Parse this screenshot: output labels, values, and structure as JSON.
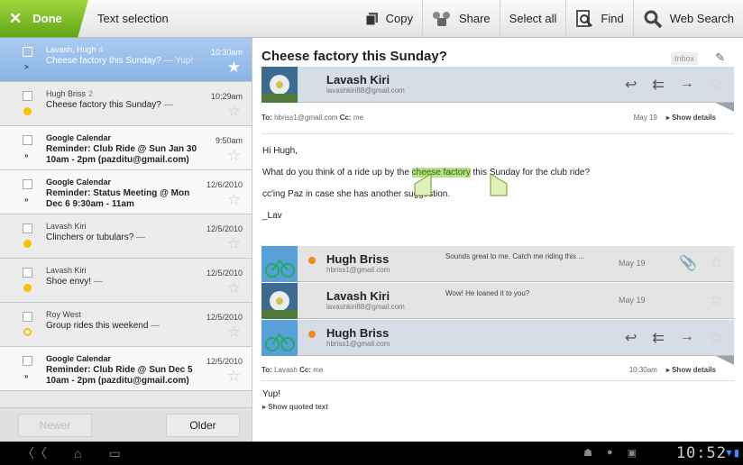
{
  "topbar": {
    "done_label": "Done",
    "title": "Text selection",
    "actions": {
      "copy": "Copy",
      "share": "Share",
      "select_all": "Select all",
      "find": "Find",
      "web_search": "Web Search"
    }
  },
  "list": [
    {
      "from": "Lavash, Hugh",
      "count": "4",
      "subject": "Cheese factory this Sunday?",
      "snippet": " — Yup!",
      "date": "10:30am",
      "bold": false,
      "selected": true,
      "marker": ">"
    },
    {
      "from": "Hugh Briss",
      "count": "2",
      "subject": "Cheese factory this Sunday?",
      "snippet": " —",
      "date": "10:29am",
      "bold": false,
      "selected": false,
      "marker": "yellow"
    },
    {
      "from": "Google Calendar",
      "count": "",
      "subject": "Reminder: Club Ride @ Sun Jan 30 10am - 2pm (pazditu@gmail.com)",
      "snippet": "",
      "date": "9:50am",
      "bold": true,
      "selected": false,
      "marker": "»"
    },
    {
      "from": "Google Calendar",
      "count": "",
      "subject": "Reminder: Status Meeting @ Mon Dec 6 9:30am - 11am",
      "snippet": "",
      "date": "12/6/2010",
      "bold": true,
      "selected": false,
      "marker": "»"
    },
    {
      "from": "Lavash Kiri",
      "count": "",
      "subject": "Clinchers or tubulars?",
      "snippet": " —",
      "date": "12/5/2010",
      "bold": false,
      "selected": false,
      "marker": "yellow"
    },
    {
      "from": "Lavash Kiri",
      "count": "",
      "subject": "Shoe envy!",
      "snippet": " —",
      "date": "12/5/2010",
      "bold": false,
      "selected": false,
      "marker": "yellow"
    },
    {
      "from": "Roy West",
      "count": "",
      "subject": "Group rides this weekend",
      "snippet": " —",
      "date": "12/5/2010",
      "bold": false,
      "selected": false,
      "marker": "outline"
    },
    {
      "from": "Google Calendar",
      "count": "",
      "subject": "Reminder: Club Ride @ Sun Dec 5 10am - 2pm (pazditu@gmail.com)",
      "snippet": "",
      "date": "12/5/2010",
      "bold": true,
      "selected": false,
      "marker": "»"
    }
  ],
  "pager": {
    "newer": "Newer",
    "older": "Older"
  },
  "message": {
    "subject": "Cheese factory this Sunday?",
    "inbox_label": "Inbox",
    "sender": {
      "name": "Lavash Kiri",
      "email": "lavashkiri88@gmail.com"
    },
    "to_label": "To:",
    "to": "hbriss1@gmail.com",
    "cc_label": "Cc:",
    "cc": "me",
    "date": "May 19",
    "show_details": "Show details",
    "body": {
      "line1": "Hi Hugh,",
      "line2_pre": "What do you think of a ride up by the ",
      "line2_hl": "cheese factory",
      "line2_post": " this Sunday for the club ride?",
      "line3": "cc'ing Paz in case she has another suggestion.",
      "line4": "_Lav"
    }
  },
  "thread": [
    {
      "name": "Hugh Briss",
      "email": "hbriss1@gmail.com",
      "snippet": "Sounds great to me. Catch me riding this ...",
      "date": "May 19"
    },
    {
      "name": "Lavash Kiri",
      "email": "lavashkiri88@gmail.com",
      "snippet": "Wow! He loaned it to you?",
      "date": "May 19"
    },
    {
      "name": "Hugh Briss",
      "email": "hbriss1@gmail.com"
    }
  ],
  "reply_meta": {
    "to_label": "To:",
    "to": "Lavash",
    "cc_label": "Cc:",
    "cc": "me",
    "time": "10:30am",
    "show_details": "Show details"
  },
  "reply_body": {
    "text": "Yup!",
    "show_quoted": "Show quoted text"
  },
  "status": {
    "clock": "10:52"
  },
  "colors": {
    "accent_green": "#62a319",
    "selected_blue": "#8ab4e6",
    "highlight": "#b9df8c"
  }
}
